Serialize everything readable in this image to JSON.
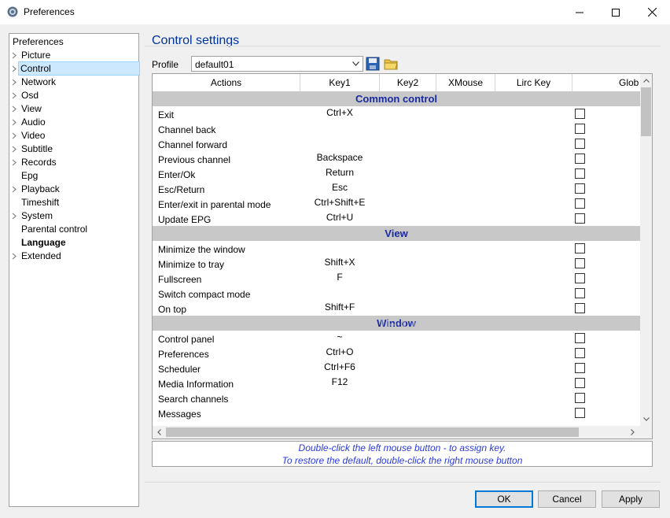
{
  "window": {
    "title": "Preferences"
  },
  "tree": {
    "root": "Preferences",
    "items": [
      {
        "label": "Picture",
        "arrow": true
      },
      {
        "label": "Control",
        "arrow": true,
        "selected": true
      },
      {
        "label": "Network",
        "arrow": true
      },
      {
        "label": "Osd",
        "arrow": true
      },
      {
        "label": "View",
        "arrow": true
      },
      {
        "label": "Audio",
        "arrow": true
      },
      {
        "label": "Video",
        "arrow": true
      },
      {
        "label": "Subtitle",
        "arrow": true
      },
      {
        "label": "Records",
        "arrow": true
      },
      {
        "label": "Epg",
        "arrow": false
      },
      {
        "label": "Playback",
        "arrow": true
      },
      {
        "label": "Timeshift",
        "arrow": false
      },
      {
        "label": "System",
        "arrow": true
      },
      {
        "label": "Parental control",
        "arrow": false
      },
      {
        "label": "Language",
        "arrow": false,
        "bold": true
      },
      {
        "label": "Extended",
        "arrow": true
      }
    ]
  },
  "panel": {
    "title": "Control settings",
    "profile_label": "Profile",
    "profile_value": "default01"
  },
  "grid": {
    "columns": [
      "Actions",
      "Key1",
      "Key2",
      "XMouse",
      "Lirc Key",
      "Glob"
    ],
    "rows": [
      {
        "section": "Common control"
      },
      {
        "action": "Exit",
        "key1": "Ctrl+X"
      },
      {
        "action": "Channel back",
        "key1": ""
      },
      {
        "action": "Channel forward",
        "key1": ""
      },
      {
        "action": "Previous channel",
        "key1": "Backspace"
      },
      {
        "action": "Enter/Ok",
        "key1": "Return"
      },
      {
        "action": "Esc/Return",
        "key1": "Esc"
      },
      {
        "action": "Enter/exit in parental mode",
        "key1": "Ctrl+Shift+E"
      },
      {
        "action": "Update EPG",
        "key1": "Ctrl+U"
      },
      {
        "section": "View"
      },
      {
        "action": "Minimize the window",
        "key1": ""
      },
      {
        "action": "Minimize to tray",
        "key1": "Shift+X"
      },
      {
        "action": "Fullscreen",
        "key1": "F"
      },
      {
        "action": "Switch compact mode",
        "key1": ""
      },
      {
        "action": "On top",
        "key1": "Shift+F"
      },
      {
        "section": "Window"
      },
      {
        "action": "Control panel",
        "key1": "~"
      },
      {
        "action": "Preferences",
        "key1": "Ctrl+O"
      },
      {
        "action": "Scheduler",
        "key1": "Ctrl+F6"
      },
      {
        "action": "Media Information",
        "key1": "F12"
      },
      {
        "action": "Search channels",
        "key1": ""
      },
      {
        "action": "Messages",
        "key1": ""
      }
    ]
  },
  "hint": {
    "line1": "Double-click the left mouse button - to assign key.",
    "line2": "To restore the default, double-click the right mouse button"
  },
  "buttons": {
    "ok": "OK",
    "cancel": "Cancel",
    "apply": "Apply"
  },
  "watermark": "SOFTPEDIA",
  "colors": {
    "accent": "#0078d7",
    "section_bg": "#c8c8c8",
    "section_text": "#1a2aa0",
    "hint_text": "#2a3ad8",
    "title_text": "#003399"
  }
}
